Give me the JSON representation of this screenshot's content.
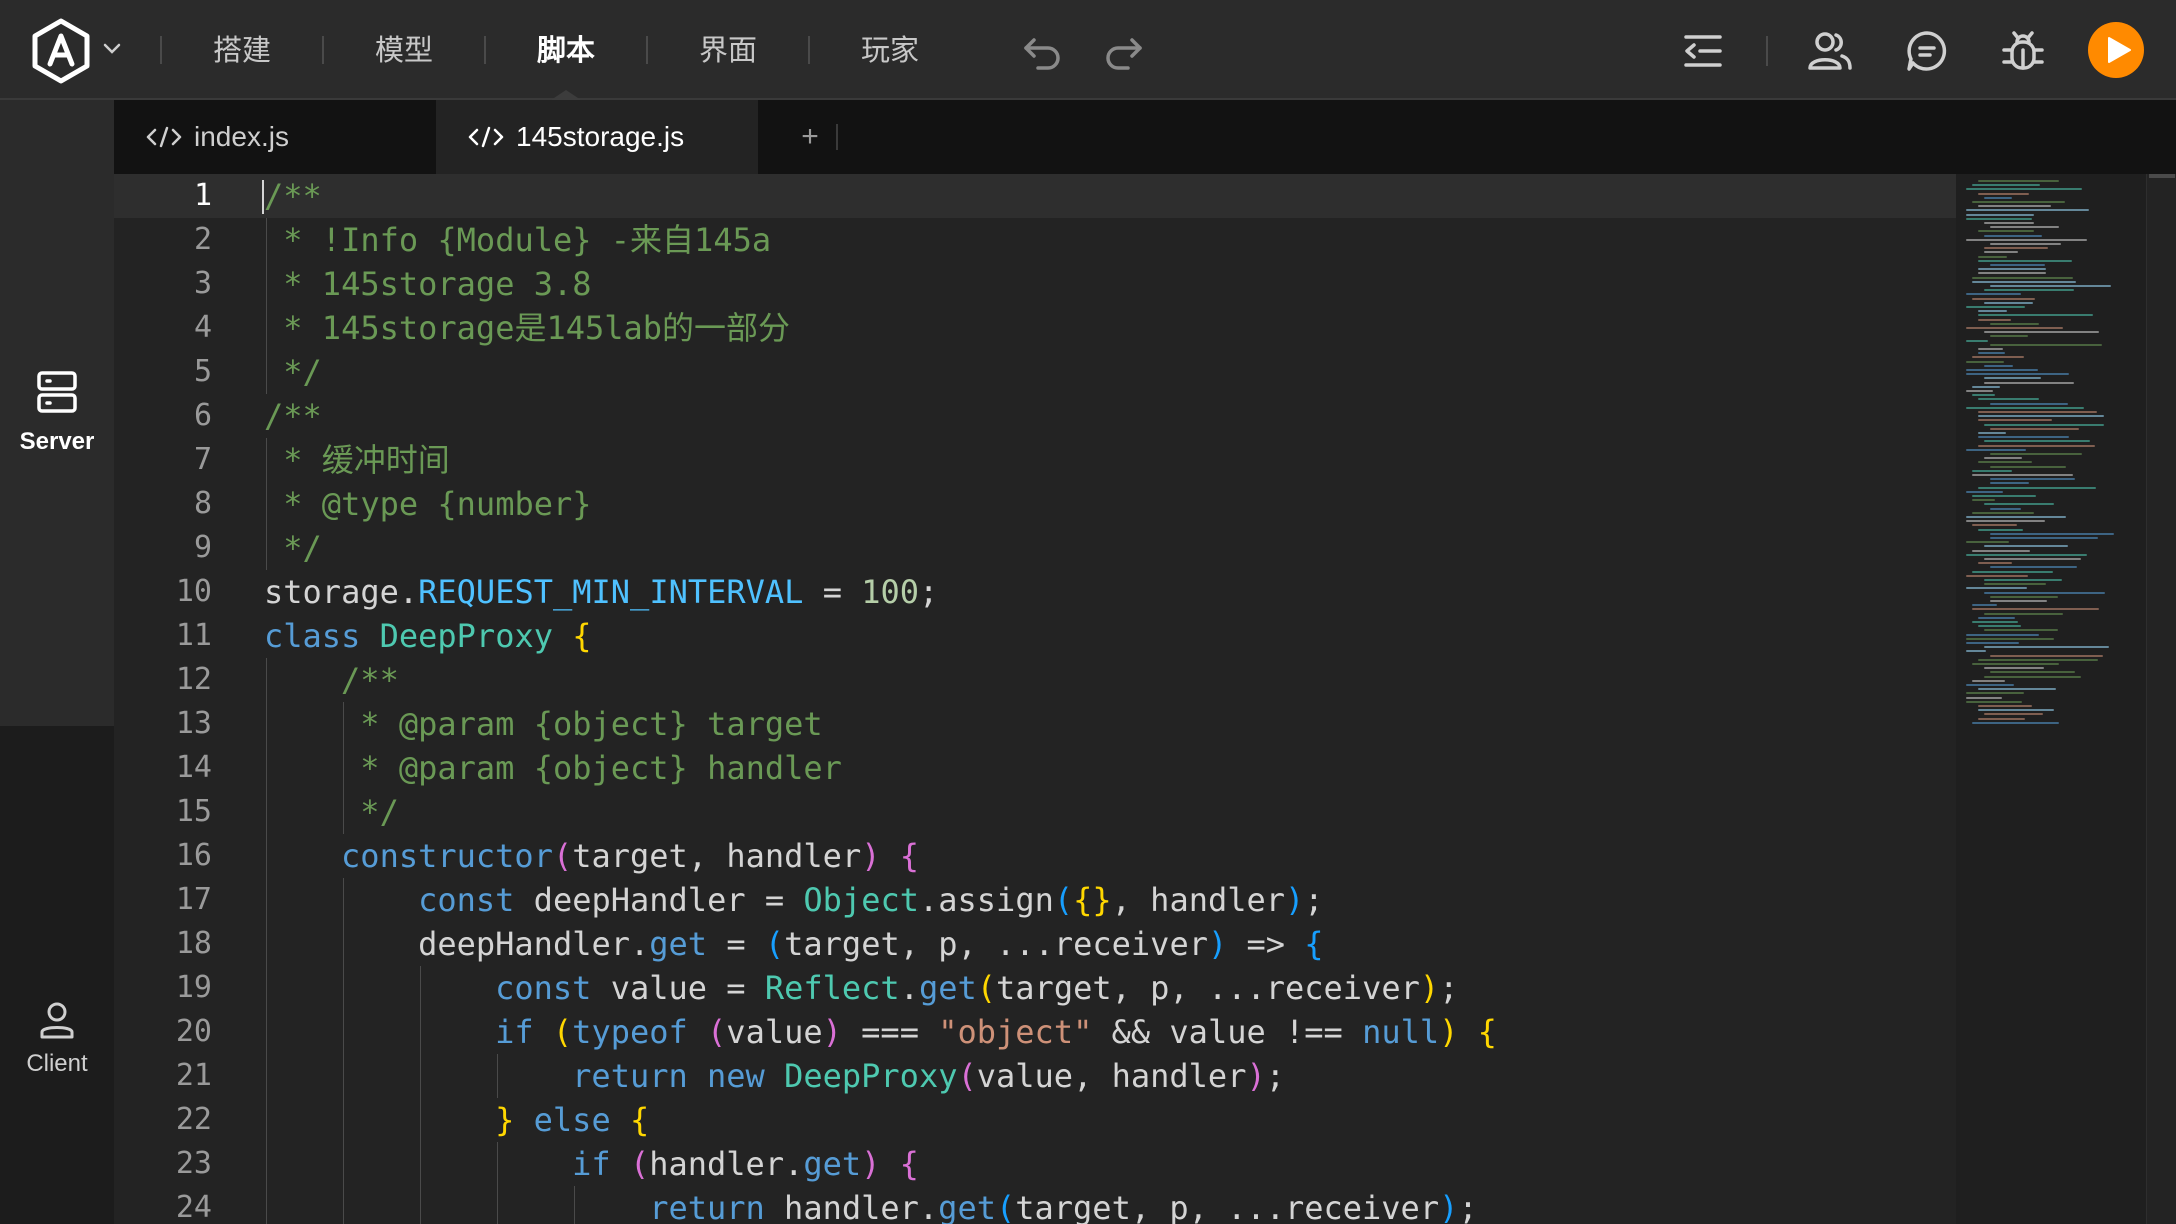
{
  "topbar": {
    "tabs": [
      {
        "label": "搭建"
      },
      {
        "label": "模型"
      },
      {
        "label": "脚本"
      },
      {
        "label": "界面"
      },
      {
        "label": "玩家"
      }
    ],
    "active_tab": "脚本",
    "accent_color": "#ff8a00"
  },
  "sidebar": {
    "server_label": "Server",
    "client_label": "Client"
  },
  "file_tabs": [
    {
      "name": "index.js"
    },
    {
      "name": "145storage.js"
    }
  ],
  "add_tab_label": "+",
  "editor": {
    "current_line": 1,
    "line_numbers": [
      "1",
      "2",
      "3",
      "4",
      "5",
      "6",
      "7",
      "8",
      "9",
      "10",
      "11",
      "12",
      "13",
      "14",
      "15",
      "16",
      "17",
      "18",
      "19",
      "20",
      "21",
      "22",
      "23",
      "24"
    ],
    "lines": [
      {
        "indent": 0,
        "tokens": [
          {
            "c": "c",
            "t": "/**"
          }
        ]
      },
      {
        "indent": 0,
        "tokens": [
          {
            "c": "c",
            "t": " * !Info {Module} -来自145a"
          }
        ]
      },
      {
        "indent": 0,
        "tokens": [
          {
            "c": "c",
            "t": " * 145storage 3.8"
          }
        ]
      },
      {
        "indent": 0,
        "tokens": [
          {
            "c": "c",
            "t": " * 145storage是145lab的一部分"
          }
        ]
      },
      {
        "indent": 0,
        "tokens": [
          {
            "c": "c",
            "t": " */"
          }
        ]
      },
      {
        "indent": 0,
        "tokens": [
          {
            "c": "c",
            "t": "/**"
          }
        ]
      },
      {
        "indent": 0,
        "tokens": [
          {
            "c": "c",
            "t": " * 缓冲时间"
          }
        ]
      },
      {
        "indent": 0,
        "tokens": [
          {
            "c": "c",
            "t": " * @type {number}"
          }
        ]
      },
      {
        "indent": 0,
        "tokens": [
          {
            "c": "c",
            "t": " */"
          }
        ]
      },
      {
        "indent": 0,
        "tokens": [
          {
            "c": "d",
            "t": "storage."
          },
          {
            "c": "p",
            "t": "REQUEST_MIN_INTERVAL"
          },
          {
            "c": "d",
            "t": " = "
          },
          {
            "c": "n",
            "t": "100"
          },
          {
            "c": "d",
            "t": ";"
          }
        ]
      },
      {
        "indent": 0,
        "tokens": [
          {
            "c": "k",
            "t": "class"
          },
          {
            "c": "d",
            "t": " "
          },
          {
            "c": "t",
            "t": "DeepProxy"
          },
          {
            "c": "d",
            "t": " "
          },
          {
            "c": "b1",
            "t": "{"
          }
        ]
      },
      {
        "indent": 1,
        "tokens": [
          {
            "c": "c",
            "t": "/**"
          }
        ]
      },
      {
        "indent": 1,
        "tokens": [
          {
            "c": "c",
            "t": " * @param {object} target"
          }
        ]
      },
      {
        "indent": 1,
        "tokens": [
          {
            "c": "c",
            "t": " * @param {object} handler"
          }
        ]
      },
      {
        "indent": 1,
        "tokens": [
          {
            "c": "c",
            "t": " */"
          }
        ]
      },
      {
        "indent": 1,
        "tokens": [
          {
            "c": "k",
            "t": "constructor"
          },
          {
            "c": "b2",
            "t": "("
          },
          {
            "c": "d",
            "t": "target, handler"
          },
          {
            "c": "b2",
            "t": ")"
          },
          {
            "c": "d",
            "t": " "
          },
          {
            "c": "b2",
            "t": "{"
          }
        ]
      },
      {
        "indent": 2,
        "tokens": [
          {
            "c": "k",
            "t": "const"
          },
          {
            "c": "d",
            "t": " deepHandler = "
          },
          {
            "c": "t",
            "t": "Object"
          },
          {
            "c": "d",
            "t": ".assign"
          },
          {
            "c": "b3",
            "t": "("
          },
          {
            "c": "b1",
            "t": "{}"
          },
          {
            "c": "d",
            "t": ", handler"
          },
          {
            "c": "b3",
            "t": ")"
          },
          {
            "c": "d",
            "t": ";"
          }
        ]
      },
      {
        "indent": 2,
        "tokens": [
          {
            "c": "d",
            "t": "deepHandler."
          },
          {
            "c": "k",
            "t": "get"
          },
          {
            "c": "d",
            "t": " = "
          },
          {
            "c": "b3",
            "t": "("
          },
          {
            "c": "d",
            "t": "target, p, ...receiver"
          },
          {
            "c": "b3",
            "t": ")"
          },
          {
            "c": "d",
            "t": " => "
          },
          {
            "c": "b3",
            "t": "{"
          }
        ]
      },
      {
        "indent": 3,
        "tokens": [
          {
            "c": "k",
            "t": "const"
          },
          {
            "c": "d",
            "t": " value = "
          },
          {
            "c": "t",
            "t": "Reflect"
          },
          {
            "c": "d",
            "t": "."
          },
          {
            "c": "k",
            "t": "get"
          },
          {
            "c": "b1",
            "t": "("
          },
          {
            "c": "d",
            "t": "target, p, ...receiver"
          },
          {
            "c": "b1",
            "t": ")"
          },
          {
            "c": "d",
            "t": ";"
          }
        ]
      },
      {
        "indent": 3,
        "tokens": [
          {
            "c": "k",
            "t": "if"
          },
          {
            "c": "d",
            "t": " "
          },
          {
            "c": "b1",
            "t": "("
          },
          {
            "c": "k",
            "t": "typeof"
          },
          {
            "c": "d",
            "t": " "
          },
          {
            "c": "b2",
            "t": "("
          },
          {
            "c": "d",
            "t": "value"
          },
          {
            "c": "b2",
            "t": ")"
          },
          {
            "c": "d",
            "t": " === "
          },
          {
            "c": "s",
            "t": "\"object\""
          },
          {
            "c": "d",
            "t": " && value !== "
          },
          {
            "c": "k",
            "t": "null"
          },
          {
            "c": "b1",
            "t": ")"
          },
          {
            "c": "d",
            "t": " "
          },
          {
            "c": "b1",
            "t": "{"
          }
        ]
      },
      {
        "indent": 4,
        "tokens": [
          {
            "c": "k",
            "t": "return"
          },
          {
            "c": "d",
            "t": " "
          },
          {
            "c": "k",
            "t": "new"
          },
          {
            "c": "d",
            "t": " "
          },
          {
            "c": "t",
            "t": "DeepProxy"
          },
          {
            "c": "b2",
            "t": "("
          },
          {
            "c": "d",
            "t": "value, handler"
          },
          {
            "c": "b2",
            "t": ")"
          },
          {
            "c": "d",
            "t": ";"
          }
        ]
      },
      {
        "indent": 3,
        "tokens": [
          {
            "c": "b1",
            "t": "}"
          },
          {
            "c": "d",
            "t": " "
          },
          {
            "c": "k",
            "t": "else"
          },
          {
            "c": "d",
            "t": " "
          },
          {
            "c": "b1",
            "t": "{"
          }
        ]
      },
      {
        "indent": 4,
        "tokens": [
          {
            "c": "k",
            "t": "if"
          },
          {
            "c": "d",
            "t": " "
          },
          {
            "c": "b2",
            "t": "("
          },
          {
            "c": "d",
            "t": "handler."
          },
          {
            "c": "k",
            "t": "get"
          },
          {
            "c": "b2",
            "t": ")"
          },
          {
            "c": "d",
            "t": " "
          },
          {
            "c": "b2",
            "t": "{"
          }
        ]
      },
      {
        "indent": 5,
        "tokens": [
          {
            "c": "k",
            "t": "return"
          },
          {
            "c": "d",
            "t": " handler."
          },
          {
            "c": "k",
            "t": "get"
          },
          {
            "c": "b3",
            "t": "("
          },
          {
            "c": "d",
            "t": "target, p, ...receiver"
          },
          {
            "c": "b3",
            "t": ")"
          },
          {
            "c": "d",
            "t": ";"
          }
        ]
      }
    ]
  }
}
